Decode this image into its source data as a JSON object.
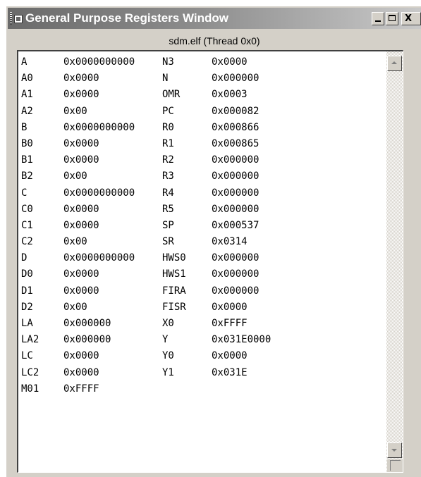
{
  "window": {
    "title": "General Purpose Registers Window",
    "subtitle": "sdm.elf (Thread 0x0)",
    "controls": {
      "minimize": "_",
      "maximize": "□",
      "close": "X"
    }
  },
  "icons": {
    "title_icon": "window-icon",
    "scroll_up": "arrow-up-icon",
    "scroll_down": "arrow-down-icon"
  },
  "rows": [
    {
      "n1": "A",
      "v1": "0x0000000000",
      "n2": "N3",
      "v2": "0x0000"
    },
    {
      "n1": "A0",
      "v1": "0x0000",
      "n2": "N",
      "v2": "0x000000"
    },
    {
      "n1": "A1",
      "v1": "0x0000",
      "n2": "OMR",
      "v2": "0x0003"
    },
    {
      "n1": "A2",
      "v1": "0x00",
      "n2": "PC",
      "v2": "0x000082"
    },
    {
      "n1": "B",
      "v1": "0x0000000000",
      "n2": "R0",
      "v2": "0x000866"
    },
    {
      "n1": "B0",
      "v1": "0x0000",
      "n2": "R1",
      "v2": "0x000865"
    },
    {
      "n1": "B1",
      "v1": "0x0000",
      "n2": "R2",
      "v2": "0x000000"
    },
    {
      "n1": "B2",
      "v1": "0x00",
      "n2": "R3",
      "v2": "0x000000"
    },
    {
      "n1": "C",
      "v1": "0x0000000000",
      "n2": "R4",
      "v2": "0x000000"
    },
    {
      "n1": "C0",
      "v1": "0x0000",
      "n2": "R5",
      "v2": "0x000000"
    },
    {
      "n1": "C1",
      "v1": "0x0000",
      "n2": "SP",
      "v2": "0x000537"
    },
    {
      "n1": "C2",
      "v1": "0x00",
      "n2": "SR",
      "v2": "0x0314"
    },
    {
      "n1": "D",
      "v1": "0x0000000000",
      "n2": "HWS0",
      "v2": "0x000000"
    },
    {
      "n1": "D0",
      "v1": "0x0000",
      "n2": "HWS1",
      "v2": "0x000000"
    },
    {
      "n1": "D1",
      "v1": "0x0000",
      "n2": "FIRA",
      "v2": "0x000000"
    },
    {
      "n1": "D2",
      "v1": "0x00",
      "n2": "FISR",
      "v2": "0x0000"
    },
    {
      "n1": "LA",
      "v1": "0x000000",
      "n2": "X0",
      "v2": "0xFFFF"
    },
    {
      "n1": "LA2",
      "v1": "0x000000",
      "n2": "Y",
      "v2": "0x031E0000"
    },
    {
      "n1": "LC",
      "v1": "0x0000",
      "n2": "Y0",
      "v2": "0x0000"
    },
    {
      "n1": "LC2",
      "v1": "0x0000",
      "n2": "Y1",
      "v2": "0x031E"
    },
    {
      "n1": "M01",
      "v1": "0xFFFF",
      "n2": "",
      "v2": ""
    }
  ]
}
